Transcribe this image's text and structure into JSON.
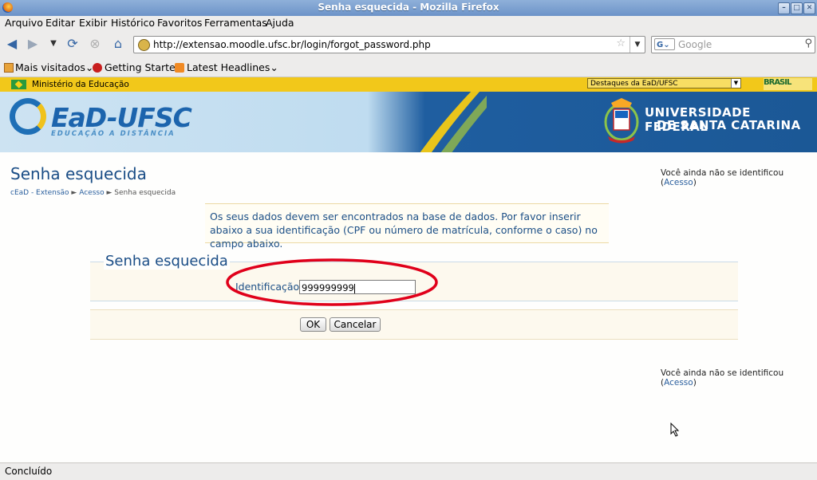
{
  "window": {
    "title": "Senha esquecida - Mozilla Firefox"
  },
  "menubar": {
    "items": [
      "Arquivo",
      "Editar",
      "Exibir",
      "Histórico",
      "Favoritos",
      "Ferramentas",
      "Ajuda"
    ]
  },
  "navbar": {
    "url": "http://extensao.moodle.ufsc.br/login/forgot_password.php",
    "search_placeholder": "Google",
    "search_engine": "G"
  },
  "bookmarks": {
    "items": [
      "Mais visitados",
      "Getting Started",
      "Latest Headlines"
    ]
  },
  "gov_bar": {
    "label": "Ministério da Educação",
    "select_value": "Destaques da EaD/UFSC",
    "brasil_logo": "BRASIL"
  },
  "banner": {
    "logo_text": "EaD-UFSC",
    "logo_subtitle": "EDUCAÇÃO A DISTÂNCIA",
    "university_line1": "UNIVERSIDADE FEDERAL",
    "university_line2": "DE SANTA CATARINA"
  },
  "page": {
    "title": "Senha esquecida",
    "login_info_text": "Você ainda não se identificou (",
    "login_link": "Acesso",
    "login_info_close": ")",
    "breadcrumb": [
      "cEaD - Extensão",
      "Acesso",
      "Senha esquecida"
    ],
    "breadcrumb_sep": "►",
    "notice": "Os seus dados devem ser encontrados na base de dados. Por favor inserir abaixo a sua identificação (CPF ou número de matrícula, conforme o caso) no campo abaixo.",
    "form": {
      "legend": "Senha esquecida",
      "ident_label": "Identificação",
      "ident_value": "999999999",
      "ok_label": "OK",
      "cancel_label": "Cancelar"
    }
  },
  "status": {
    "text": "Concluído"
  },
  "colors": {
    "link": "#2a5f9e",
    "heading": "#1a4d86",
    "annotation_ellipse": "#e0001a",
    "gov_bar": "#f2c81a"
  }
}
